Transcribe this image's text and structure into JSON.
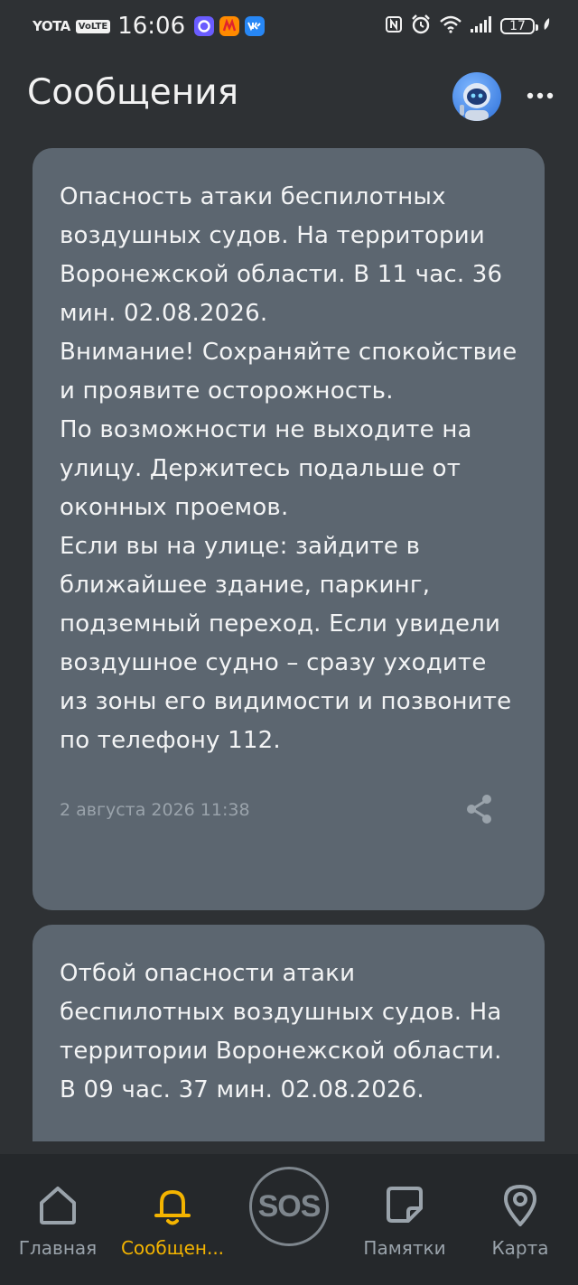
{
  "status_bar": {
    "carrier": "YOTA",
    "volte": "VoLTE",
    "time": "16:06",
    "battery": "17"
  },
  "header": {
    "title": "Сообщения"
  },
  "messages": [
    {
      "text": "Опасность атаки беспилотных воздушных судов. На территории Воронежской области. В 11 час. 36 мин. 02.08.2026.\nВнимание! Сохраняйте спокойствие и проявите осторожность.\nПо возможности не выходите на улицу. Держитесь подальше от оконных проемов.\nЕсли вы на улице: зайдите в ближайшее здание, паркинг, подземный переход. Если увидели воздушное судно – сразу уходите из зоны его видимости и позвоните по телефону 112.",
      "date": "2 августа 2026 11:38"
    },
    {
      "text": "Отбой опасности атаки беспилотных воздушных судов. На территории Воронежской области. В 09 час. 37 мин. 02.08.2026."
    }
  ],
  "nav": {
    "home": "Главная",
    "messages": "Сообщен...",
    "sos": "SOS",
    "memos": "Памятки",
    "map": "Карта"
  },
  "colors": {
    "background": "#2e3134",
    "card": "#5c6670",
    "accent": "#f4b400",
    "nav_inactive": "#9aa3ab"
  }
}
